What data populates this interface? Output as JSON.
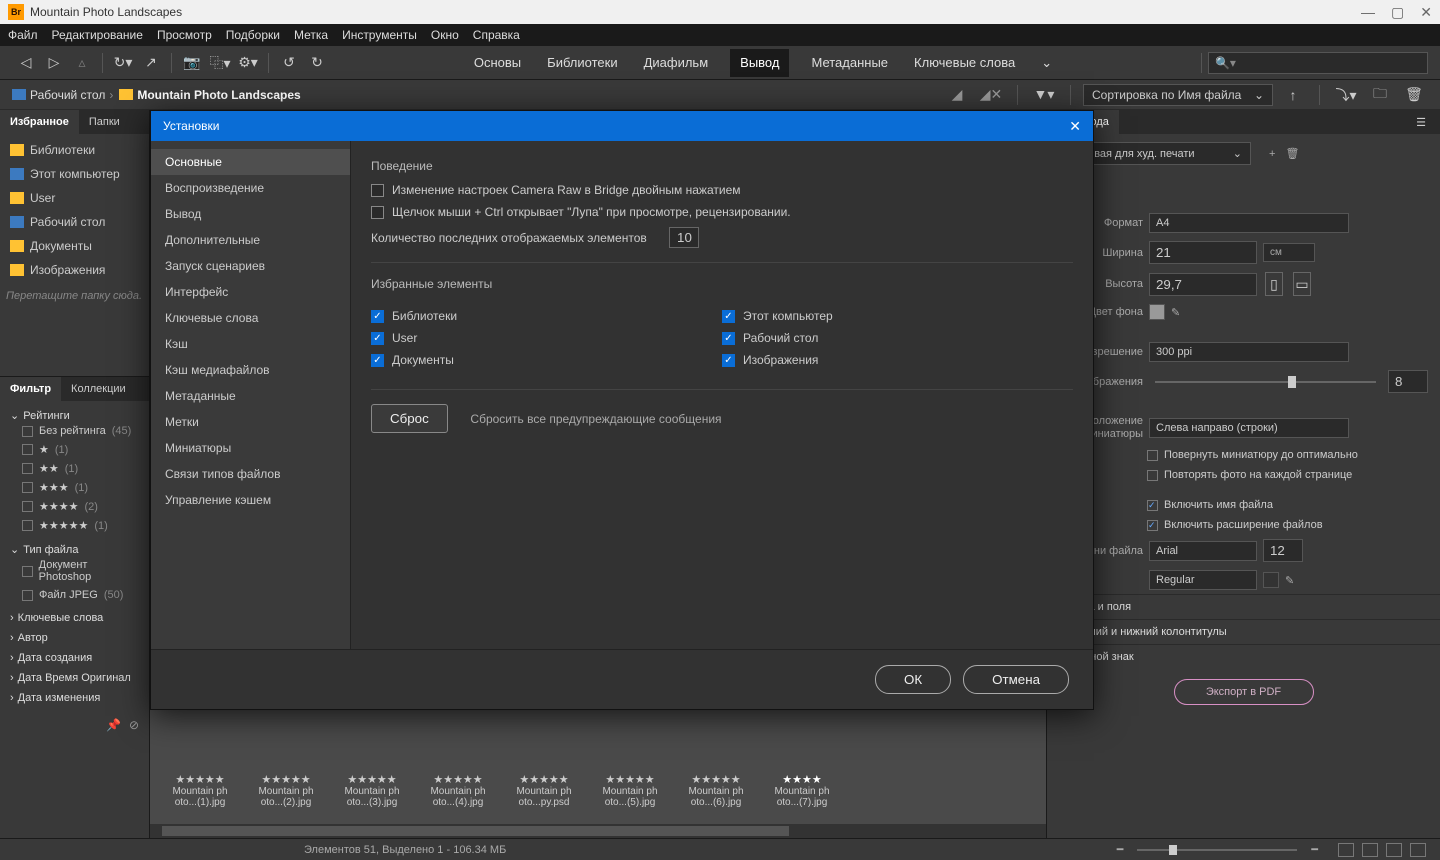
{
  "titlebar": {
    "app_icon": "Br",
    "title": "Mountain Photo Landscapes"
  },
  "menu": [
    "Файл",
    "Редактирование",
    "Просмотр",
    "Подборки",
    "Метка",
    "Инструменты",
    "Окно",
    "Справка"
  ],
  "workspaces": [
    "Основы",
    "Библиотеки",
    "Диафильм",
    "Вывод",
    "Метаданные",
    "Ключевые слова"
  ],
  "active_workspace": "Вывод",
  "path": {
    "seg1": "Рабочий стол",
    "seg2": "Mountain Photo Landscapes"
  },
  "sort_label": "Сортировка по Имя файла",
  "left_tabs": {
    "fav": "Избранное",
    "folders": "Папки"
  },
  "favorites": [
    "Библиотеки",
    "Этот компьютер",
    "User",
    "Рабочий стол",
    "Документы",
    "Изображения"
  ],
  "drop_hint": "Перетащите папку сюда.",
  "filter_tabs": {
    "filter": "Фильтр",
    "coll": "Коллекции"
  },
  "ratings_head": "Рейтинги",
  "no_rating": "Без рейтинга",
  "no_rating_count": "(45)",
  "star_counts": [
    "(1)",
    "(1)",
    "(1)",
    "(2)",
    "(1)"
  ],
  "filetype_head": "Тип файла",
  "filetypes": [
    {
      "label": "Документ Photoshop",
      "count": ""
    },
    {
      "label": "Файл JPEG",
      "count": "(50)"
    }
  ],
  "filter_more": [
    "Ключевые слова",
    "Автор",
    "Дата создания",
    "Дата Время Оригинал",
    "Дата изменения"
  ],
  "thumbs": [
    {
      "l1": "Mountain ph",
      "l2": "oto...(1).jpg"
    },
    {
      "l1": "Mountain ph",
      "l2": "oto...(2).jpg"
    },
    {
      "l1": "Mountain ph",
      "l2": "oto...(3).jpg"
    },
    {
      "l1": "Mountain ph",
      "l2": "oto...(4).jpg"
    },
    {
      "l1": "Mountain ph",
      "l2": "oto...py.psd"
    },
    {
      "l1": "Mountain ph",
      "l2": "oto...(5).jpg"
    },
    {
      "l1": "Mountain ph",
      "l2": "oto...(6).jpg"
    },
    {
      "l1": "Mountain ph",
      "l2": "oto...(7).jpg"
    }
  ],
  "right_panel": {
    "tab": "вывода",
    "template_dd": "Матовая для худ. печати",
    "format_label": "Формат",
    "format_val": "A4",
    "width_label": "Ширина",
    "width_val": "21",
    "unit": "см",
    "height_label": "Высота",
    "height_val": "29,7",
    "bg_label": "Цвет фона",
    "res_label": "Разрешение",
    "res_val": "300 ppi",
    "imgsize_label": "о изображения",
    "imgsize_val": "8",
    "thumb_layout_label": "Расположение миниатюры",
    "thumb_layout_val": "Слева направо (строки)",
    "rotate_opt": "Повернуть миниатюру до оптимально",
    "repeat_opt": "Повторять фото на каждой странице",
    "include_name": "Включить имя файла",
    "include_ext": "Включить расширение файлов",
    "font_label": "т имени файла",
    "font_val": "Arial",
    "font_size": "12",
    "font_weight": "Regular",
    "sections": [
      "Сетка и поля",
      "Верхний и нижний колонтитулы",
      "Водяной знак"
    ],
    "export_btn": "Экспорт в PDF"
  },
  "statusbar": "Элементов 51, Выделено 1 - 106.34 МБ",
  "dialog": {
    "title": "Установки",
    "nav": [
      "Основные",
      "Воспроизведение",
      "Вывод",
      "Дополнительные",
      "Запуск сценариев",
      "Интерфейс",
      "Ключевые слова",
      "Кэш",
      "Кэш медиафайлов",
      "Метаданные",
      "Метки",
      "Миниатюры",
      "Связи типов файлов",
      "Управление кэшем"
    ],
    "behavior_title": "Поведение",
    "opt_camera_raw": "Изменение настроек Camera Raw в Bridge двойным нажатием",
    "opt_ctrl_click": "Щелчок мыши + Ctrl открывает \"Лупа\" при просмотре, рецензировании.",
    "recent_label": "Количество последних отображаемых элементов",
    "recent_val": "10",
    "fav_title": "Избранные элементы",
    "fav_items_left": [
      "Библиотеки",
      "User",
      "Документы"
    ],
    "fav_items_right": [
      "Этот компьютер",
      "Рабочий стол",
      "Изображения"
    ],
    "reset_btn": "Сброс",
    "reset_label": "Сбросить все предупреждающие сообщения",
    "ok": "ОК",
    "cancel": "Отмена"
  }
}
